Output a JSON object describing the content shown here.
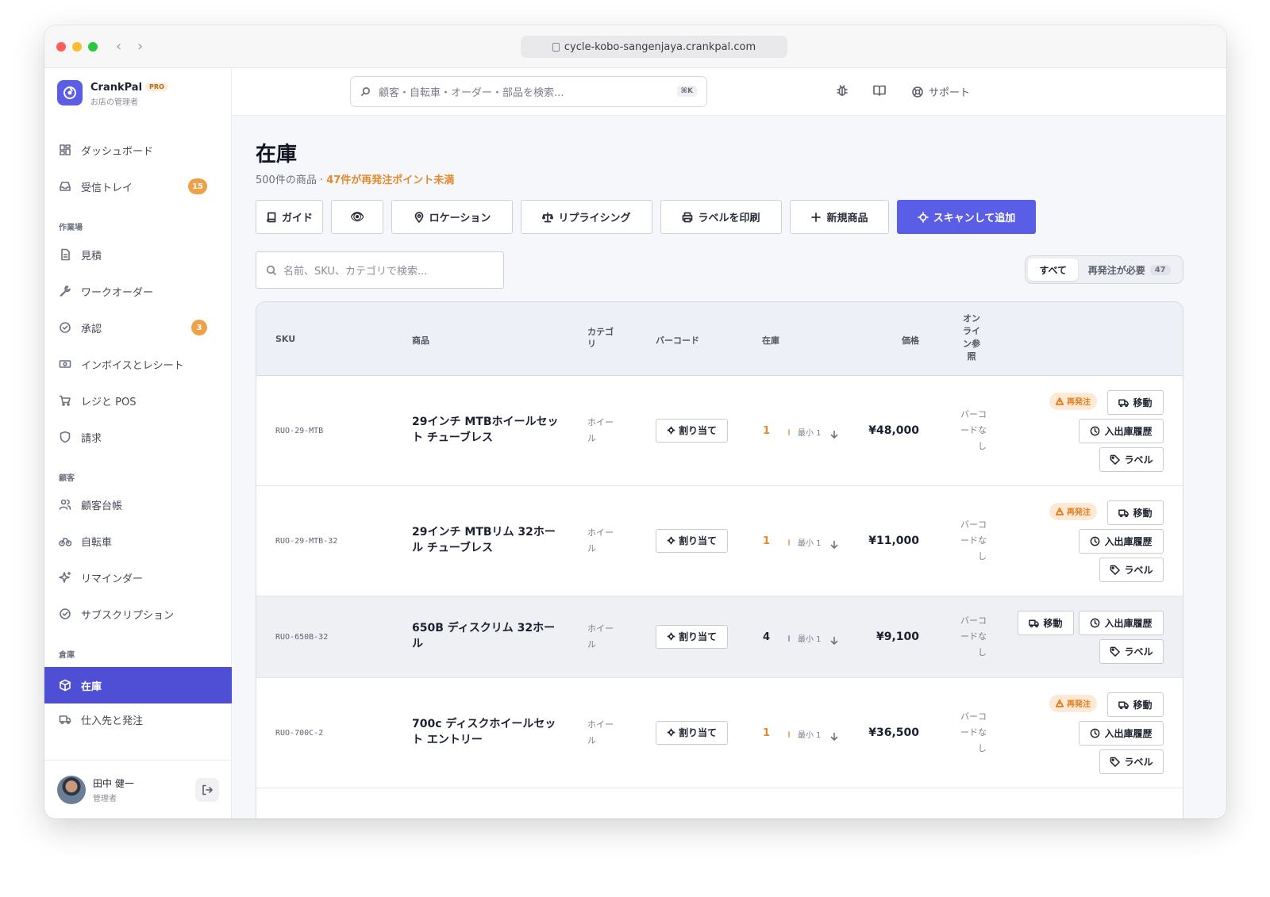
{
  "browser": {
    "url": "cycle-kobo-sangenjaya.crankpal.com"
  },
  "brand": {
    "name": "CrankPal",
    "badge": "PRO",
    "subtitle": "お店の管理者"
  },
  "global_search": {
    "placeholder": "顧客・自転車・オーダー・部品を検索...",
    "shortcut": "⌘K"
  },
  "topbar": {
    "support_label": "サポート"
  },
  "sidebar": {
    "items": [
      {
        "label": "ダッシュボード",
        "icon": "dashboard-icon"
      },
      {
        "label": "受信トレイ",
        "icon": "inbox-icon",
        "badge": "15"
      },
      {
        "label": "見積",
        "icon": "document-icon"
      },
      {
        "label": "ワークオーダー",
        "icon": "wrench-icon"
      },
      {
        "label": "承認",
        "icon": "check-circle-icon",
        "badge": "3"
      },
      {
        "label": "インボイスとレシート",
        "icon": "money-icon"
      },
      {
        "label": "レジと POS",
        "icon": "cart-icon"
      },
      {
        "label": "請求",
        "icon": "shield-icon"
      },
      {
        "label": "顧客台帳",
        "icon": "users-icon"
      },
      {
        "label": "自転車",
        "icon": "bike-icon"
      },
      {
        "label": "リマインダー",
        "icon": "sparkle-icon"
      },
      {
        "label": "サブスクリプション",
        "icon": "check-circle-icon"
      },
      {
        "label": "在庫",
        "icon": "box-icon"
      },
      {
        "label": "仕入先と発注",
        "icon": "truck-icon"
      }
    ],
    "sections": [
      "作業場",
      "顧客",
      "倉庫"
    ]
  },
  "user": {
    "name": "田中 健一",
    "role": "管理者"
  },
  "page": {
    "title": "在庫",
    "subtitle_count": "500件の商品 · ",
    "subtitle_warning": "47件が再発注ポイント未満"
  },
  "toolbar": {
    "guide": "ガイド",
    "eye": "👁",
    "location": "ロケーション",
    "repricing": "リプライシング",
    "print_labels": "ラベルを印刷",
    "new_item": "新規商品",
    "scan_add": "スキャンして追加"
  },
  "inventory_search": {
    "placeholder": "名前、SKU、カテゴリで検索..."
  },
  "filter": {
    "all": "すべて",
    "reorder": "再発注が必要",
    "reorder_count": "47"
  },
  "table": {
    "headers": {
      "sku": "SKU",
      "product": "商品",
      "category": "カテゴリ",
      "barcode": "バーコード",
      "stock": "在庫",
      "price": "価格",
      "online": "オンライン参照"
    },
    "assign_label": "割り当て",
    "move_label": "移動",
    "history_label": "入出庫履歴",
    "label_label": "ラベル",
    "reorder_badge": "再発注",
    "rows": [
      {
        "sku": "RUO-29-MTB",
        "name": "29インチ MTBホイールセット チューブレス",
        "category": "ホイール",
        "stock": "1",
        "min": "最小 1",
        "price": "¥48,000",
        "online": "バーコードなし",
        "reorder": true
      },
      {
        "sku": "RUO-29-MTB-32",
        "name": "29インチ MTBリム 32ホール チューブレス",
        "category": "ホイール",
        "stock": "1",
        "min": "最小 1",
        "price": "¥11,000",
        "online": "バーコードなし",
        "reorder": true
      },
      {
        "sku": "RUO-650B-32",
        "name": "650B ディスクリム 32ホール",
        "category": "ホイール",
        "stock": "4",
        "min": "最小 1",
        "price": "¥9,100",
        "online": "バーコードなし",
        "reorder": false
      },
      {
        "sku": "RUO-700C-2",
        "name": "700c ディスクホイールセット エントリー",
        "category": "ホイール",
        "stock": "1",
        "min": "最小 1",
        "price": "¥36,500",
        "online": "バーコードなし",
        "reorder": true
      }
    ]
  },
  "colors": {
    "accent": "#5a5ee6",
    "sidebar_active": "#4f4fd6",
    "warning": "#e48a2c"
  }
}
